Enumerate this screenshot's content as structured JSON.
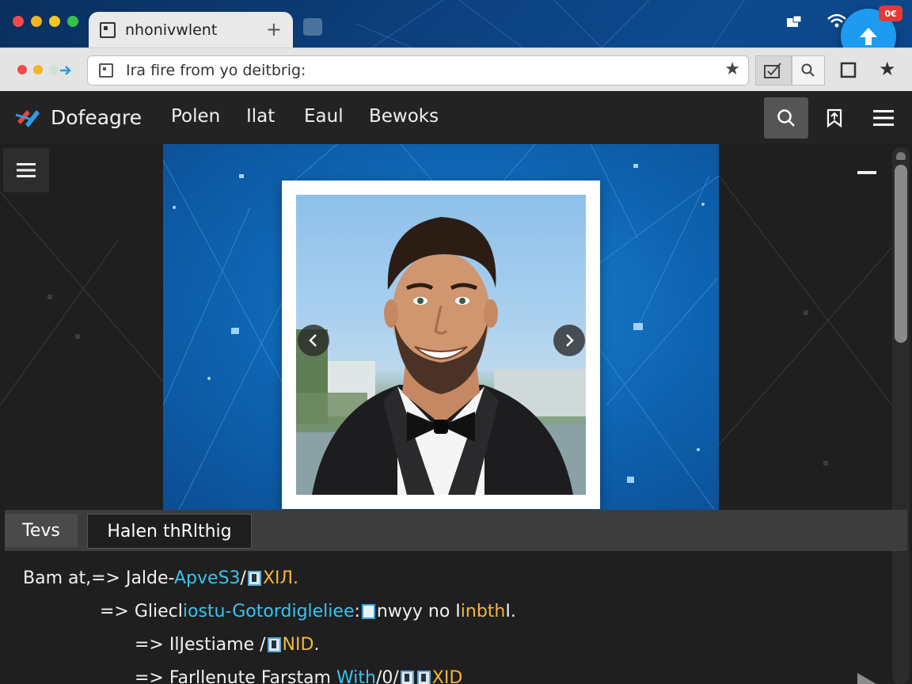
{
  "browser": {
    "tab_title": "nhonivwlent",
    "tab_plus": "+",
    "url_text": "Ira fire from yo deitbrig:",
    "tray_badge": "0€"
  },
  "app": {
    "brand": "Dofeagre",
    "nav": [
      "Polen",
      "Ilat",
      "Eaul",
      "Bewoks"
    ]
  },
  "panel": {
    "tabs": [
      "Tevs",
      "Halen thRlthig"
    ]
  },
  "code_lines": {
    "l1": {
      "a": "Bam at,=> Jalde-",
      "b": "ApveS3",
      "c": "/",
      "d": "XI",
      "e": "Л."
    },
    "l2": {
      "a": "=> Gliecl",
      "b": "iostu-Gotordigleliee",
      "c": ":",
      "d": "nwyy no I",
      "e": "inbth",
      "f": "I."
    },
    "l3": {
      "a": "=> IlJestiame /",
      "b": "NID",
      "c": "."
    },
    "l4": {
      "a": "=> Farllenute Farstam ",
      "b": "With",
      "c": "/0/",
      "d": "XID"
    }
  },
  "colors": {
    "accent_blue": "#1e9bf0",
    "code_cyan": "#38c4f2",
    "code_amber": "#f4b73a",
    "hero_blue": "#0e63b0"
  },
  "icons": [
    "tab-favicon-icon",
    "wifi-icon",
    "upload-icon",
    "bookmark-star-icon",
    "search-icon",
    "share-icon",
    "hamburger-icon",
    "chevron-left-icon",
    "chevron-right-icon"
  ]
}
